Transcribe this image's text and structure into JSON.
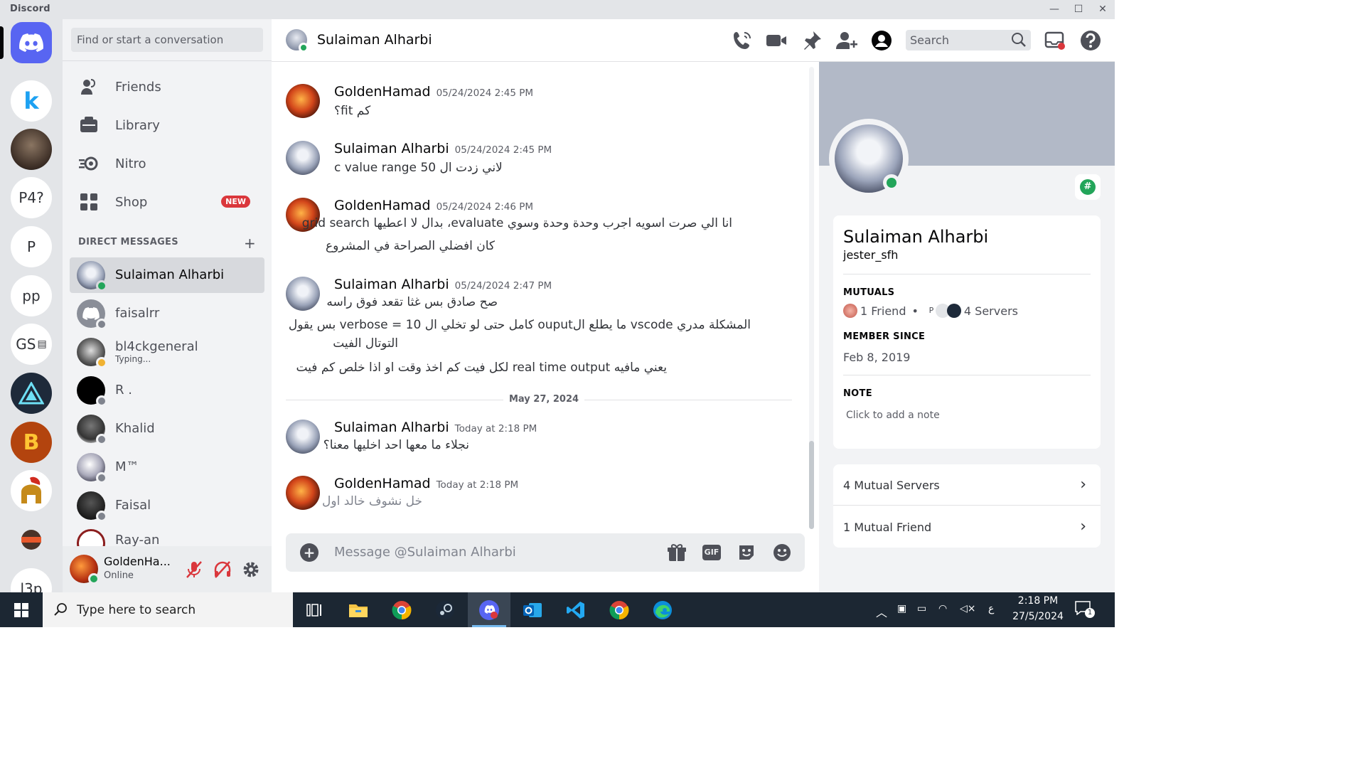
{
  "window": {
    "app_name": "Discord",
    "minimize": "—",
    "maximize": "☐",
    "close": "✕"
  },
  "rail": {
    "servers": [
      {
        "label": "k",
        "kind": "icon"
      },
      {
        "label": "",
        "kind": "photo"
      },
      {
        "label": "P4?",
        "kind": "text"
      },
      {
        "label": "P",
        "kind": "text"
      },
      {
        "label": "pp",
        "kind": "text"
      },
      {
        "label": "GS",
        "kind": "text"
      },
      {
        "label": "",
        "kind": "icon"
      },
      {
        "label": "B",
        "kind": "icon"
      },
      {
        "label": "",
        "kind": "icon"
      },
      {
        "label": "",
        "kind": "icon"
      },
      {
        "label": "l3p",
        "kind": "text"
      }
    ]
  },
  "dm_sidebar": {
    "search_placeholder": "Find or start a conversation",
    "nav": [
      {
        "label": "Friends"
      },
      {
        "label": "Library"
      },
      {
        "label": "Nitro"
      },
      {
        "label": "Shop",
        "badge": "NEW"
      }
    ],
    "section_title": "DIRECT MESSAGES",
    "add_label": "+",
    "dms": [
      {
        "name": "Sulaiman Alharbi",
        "status": "online",
        "active": true,
        "sub": ""
      },
      {
        "name": "faisalrr",
        "status": "offline",
        "sub": ""
      },
      {
        "name": "bl4ckgeneral",
        "status": "idle",
        "sub": "Typing..."
      },
      {
        "name": "R .",
        "status": "offline",
        "sub": ""
      },
      {
        "name": "Khalid",
        "status": "offline",
        "sub": ""
      },
      {
        "name": "M™",
        "status": "offline",
        "sub": ""
      },
      {
        "name": "Faisal",
        "status": "offline",
        "sub": ""
      },
      {
        "name": "Ray-an",
        "status": "offline",
        "sub": ""
      }
    ]
  },
  "user_panel": {
    "name": "GoldenHa...",
    "status": "Online"
  },
  "chat": {
    "title": "Sulaiman Alharbi",
    "search_placeholder": "Search",
    "messages": [
      {
        "author": "GoldenHamad",
        "time": "05/24/2024 2:45 PM",
        "lines": [
          "كم fit؟"
        ]
      },
      {
        "author": "Sulaiman Alharbi",
        "time": "05/24/2024 2:45 PM",
        "lines": [
          "c value range لاني زدت ال 50"
        ]
      },
      {
        "author": "GoldenHamad",
        "time": "05/24/2024 2:46 PM",
        "lines": [
          "انا الي صرت اسويه اجرب وحدة وحدة وسوي evaluate، بدال لا اعطيها grid search",
          "كان افضلي الصراحة في المشروع"
        ]
      },
      {
        "author": "Sulaiman Alharbi",
        "time": "05/24/2024 2:47 PM",
        "lines": [
          "صح صادق بس غثا تقعد فوق راسه",
          "المشكلة مدري vscode ما يطلع الouput كامل حتى لو تخلي ال verbose = 10 بس يقول",
          "التوتال الفيت",
          "يعني مافيه real time output لكل فيت كم اخذ وقت او اذا خلص كم فيت"
        ]
      },
      {
        "author": "Sulaiman Alharbi",
        "time": "Today at 2:18 PM",
        "lines": [
          "نجلاء ما معها احد اخليها معنا؟"
        ]
      },
      {
        "author": "GoldenHamad",
        "time": "Today at 2:18 PM",
        "lines": [
          "خل نشوف خالد اول"
        ]
      }
    ],
    "date_divider": "May 27, 2024",
    "composer_placeholder": "Message @Sulaiman Alharbi",
    "gif_label": "GIF"
  },
  "profile": {
    "display_name": "Sulaiman Alharbi",
    "username": "jester_sfh",
    "mutuals_title": "MUTUALS",
    "mutual_friends": "1 Friend",
    "mutual_servers": "4 Servers",
    "mutual_server_initials": "P",
    "member_since_title": "MEMBER SINCE",
    "member_since": "Feb 8, 2019",
    "note_title": "NOTE",
    "note_placeholder": "Click to add a note",
    "mutual_servers_row": "4 Mutual Servers",
    "mutual_friend_row": "1 Mutual Friend",
    "badge": "#"
  },
  "taskbar": {
    "search_placeholder": "Type here to search",
    "time": "2:18 PM",
    "date": "27/5/2024",
    "lang": "ع",
    "notifications": "1"
  },
  "colors": {
    "blurple": "#5865f2",
    "online": "#23a55a",
    "idle": "#f0b232",
    "new_badge": "#da373c",
    "banner": "#b2b9c7"
  }
}
